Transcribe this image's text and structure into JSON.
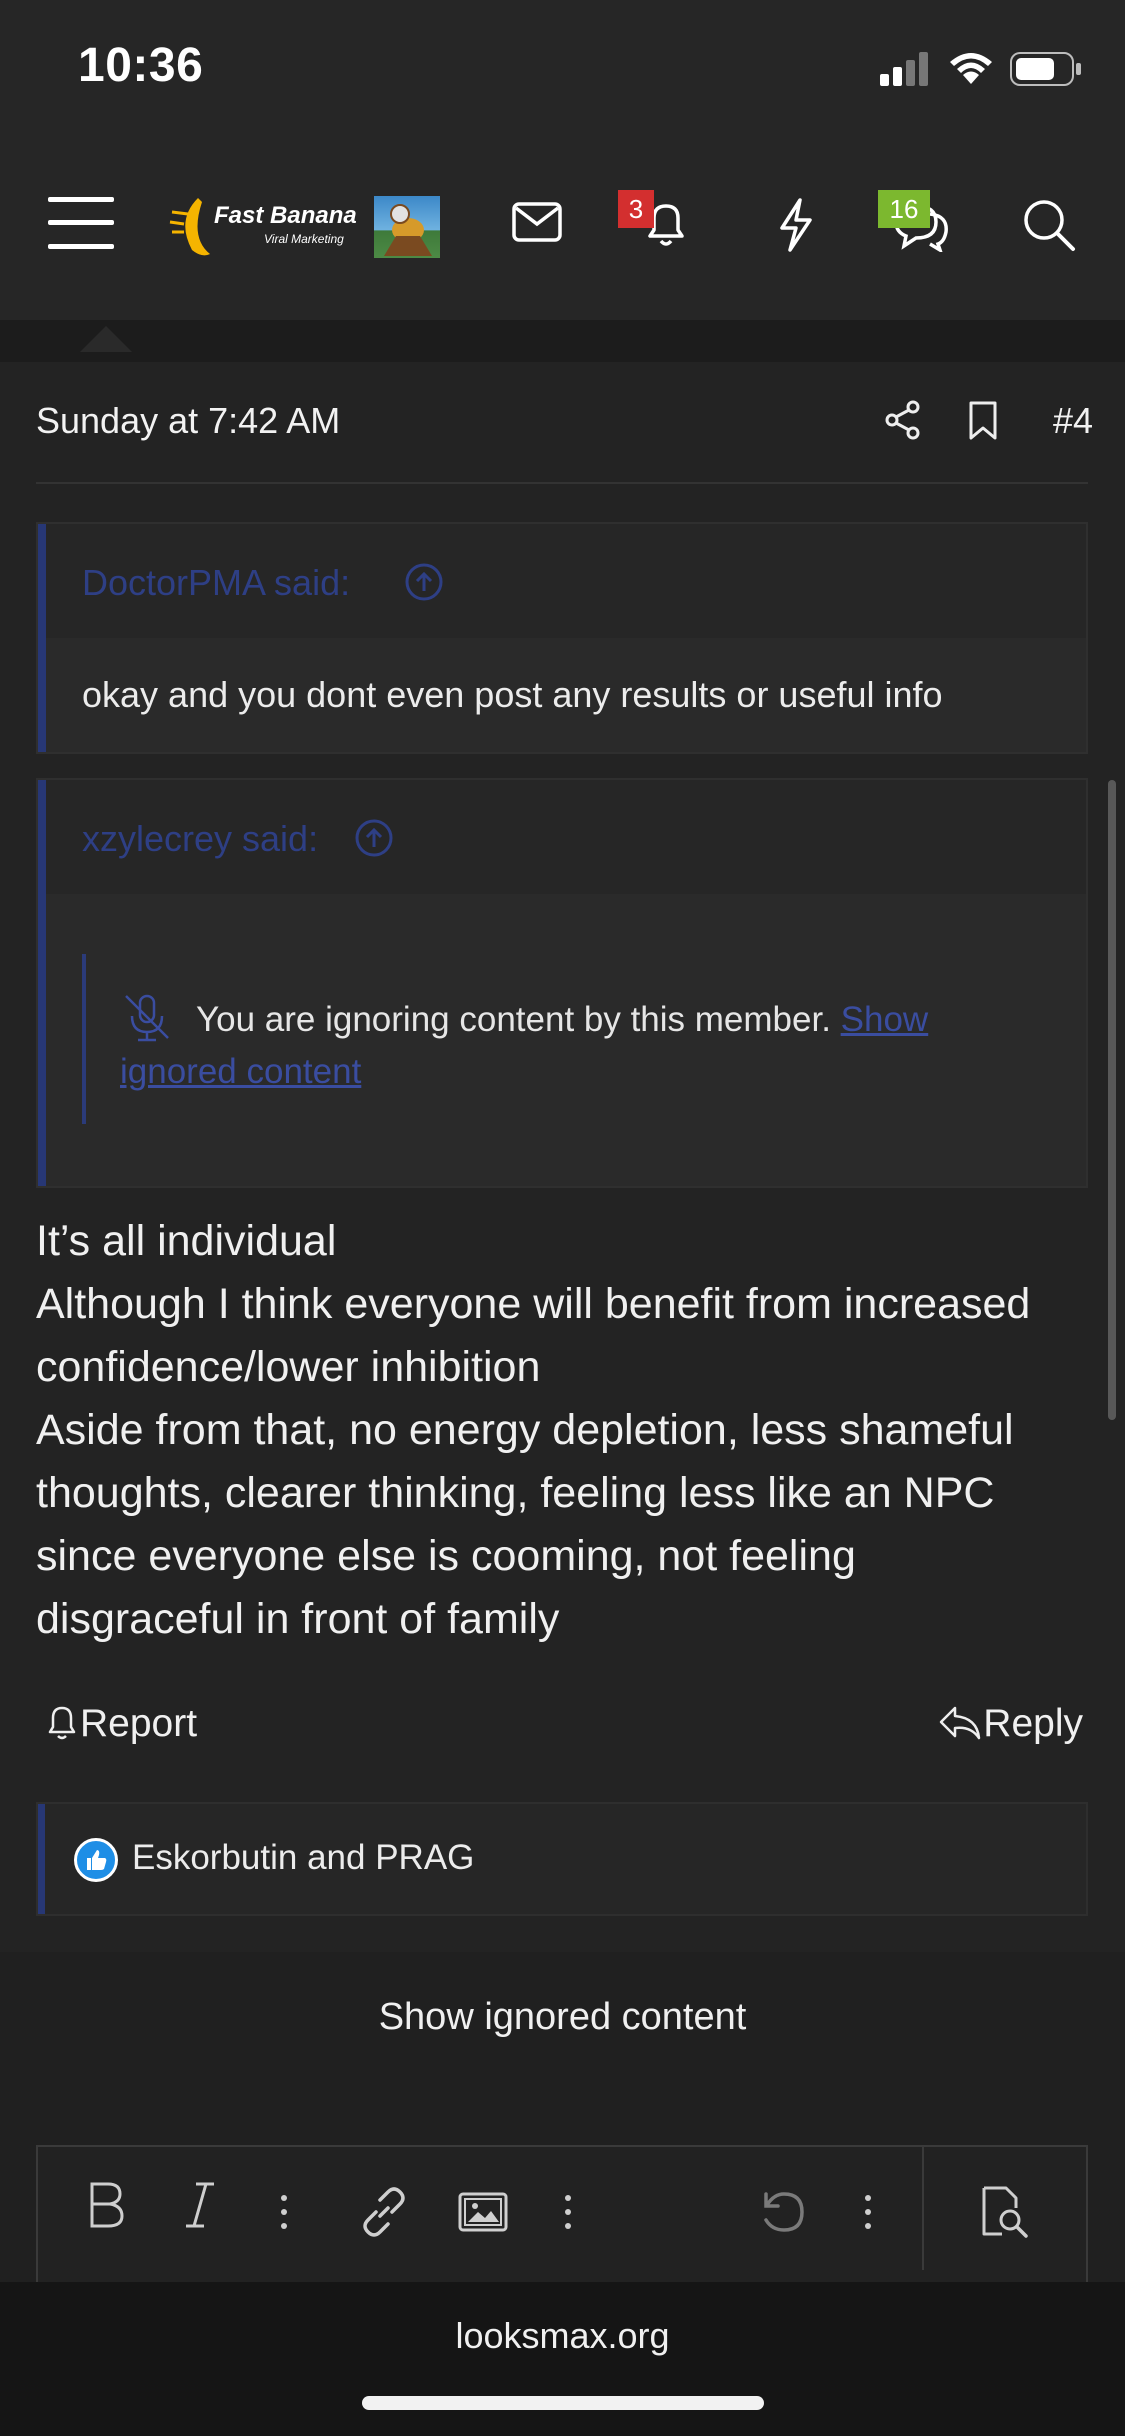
{
  "status_bar": {
    "time": "10:36",
    "battery_level": 0.65
  },
  "nav": {
    "logo_text": "Fast Banana",
    "logo_subtext": "Viral Marketing",
    "alerts_badge": "3",
    "conversations_badge": "16",
    "colors": {
      "alerts_badge": "#d32f2f",
      "conversations_badge": "#7cb82f"
    }
  },
  "post": {
    "date": "Sunday at 7:42 AM",
    "number": "#4",
    "quote1": {
      "author": "DoctorPMA said:",
      "text": "okay and you dont even post any results or useful info"
    },
    "quote2": {
      "author": "xzylecrey said:",
      "ignored_text": "You are ignoring content by this member.",
      "show_link_1": "Show",
      "show_link_2": "ignored content"
    },
    "body": [
      "It’s all individual",
      "Although I think everyone will benefit from increased",
      "confidence/lower inhibition",
      "Aside from that, no energy depletion, less shameful",
      "thoughts, clearer thinking, feeling less like an NPC",
      "since everyone else is cooming, not feeling",
      "disgraceful in front of family"
    ],
    "report_label": "Report",
    "reply_label": "Reply",
    "reactions_text": "Eskorbutin and PRAG"
  },
  "show_ignored_label": "Show ignored content",
  "url": "looksmax.org"
}
